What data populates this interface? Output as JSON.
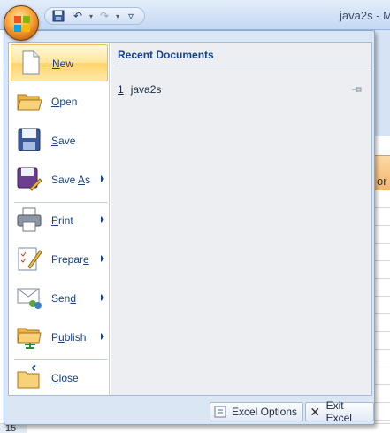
{
  "window": {
    "title": "java2s - M"
  },
  "quick_access": {
    "save_icon": "save-icon",
    "undo_icon": "undo-icon",
    "redo_icon": "redo-icon",
    "customize_icon": "customize-icon"
  },
  "menu": {
    "items": [
      {
        "label_first": "N",
        "label_rest": "ew",
        "icon": "new-document-icon",
        "has_submenu": false,
        "active": true
      },
      {
        "label_first": "O",
        "label_rest": "pen",
        "icon": "open-folder-icon",
        "has_submenu": false,
        "active": false
      },
      {
        "label_first": "S",
        "label_rest": "ave",
        "icon": "save-disk-icon",
        "has_submenu": false,
        "active": false
      },
      {
        "label_first": "Save ",
        "label_ul": "A",
        "label_rest": "s",
        "icon": "save-as-icon",
        "has_submenu": true,
        "active": false
      },
      {
        "label_first": "P",
        "label_rest": "rint",
        "icon": "printer-icon",
        "has_submenu": true,
        "active": false
      },
      {
        "label_first": "Prepar",
        "label_ul": "e",
        "label_rest": "",
        "icon": "prepare-icon",
        "has_submenu": true,
        "active": false
      },
      {
        "label_first": "Sen",
        "label_ul": "d",
        "label_rest": "",
        "icon": "send-icon",
        "has_submenu": true,
        "active": false
      },
      {
        "label_first": "P",
        "label_ul": "u",
        "label_rest": "blish",
        "icon": "publish-icon",
        "has_submenu": true,
        "active": false
      },
      {
        "label_first": "C",
        "label_rest": "lose",
        "icon": "close-folder-icon",
        "has_submenu": false,
        "active": false
      }
    ]
  },
  "recent": {
    "title": "Recent Documents",
    "items": [
      {
        "num": "1",
        "name": "java2s"
      }
    ]
  },
  "footer": {
    "options_label": "Excel Options",
    "exit_label": "Exit Excel"
  },
  "sheet": {
    "row_label": "15",
    "header_fragment": "or"
  },
  "colors": {
    "accent": "#15428b",
    "active": "#ffd36a",
    "panel": "#dbe6f5"
  }
}
